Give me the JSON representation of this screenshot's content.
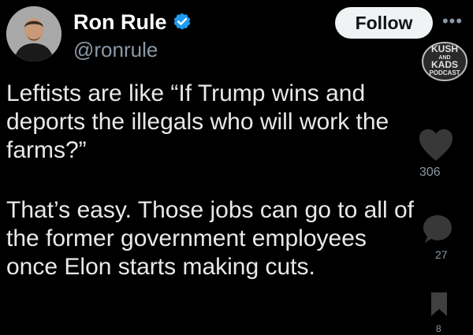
{
  "author": {
    "name": "Ron Rule",
    "handle": "@ronrule",
    "verified": true,
    "avatar_icon": "profile-photo"
  },
  "header": {
    "follow_label": "Follow",
    "more_label": "•••"
  },
  "watermark": {
    "lines": [
      "KUSH",
      "AND",
      "KADS",
      "PODCAST"
    ]
  },
  "tweet": {
    "paragraphs": [
      "Leftists are like “If Trump wins and\ndeports the illegals who will work the\nfarms?”",
      "That’s easy. Those jobs can go to all of\nthe former government employees\nonce Elon starts making cuts."
    ]
  },
  "actions": {
    "likes": "306",
    "comments": "27",
    "bookmarks": "8"
  },
  "colors": {
    "background": "#000000",
    "text": "#e7e9ea",
    "secondary": "#8b98a5",
    "verified_blue": "#1d9bf0",
    "follow_bg": "#eff3f4"
  }
}
